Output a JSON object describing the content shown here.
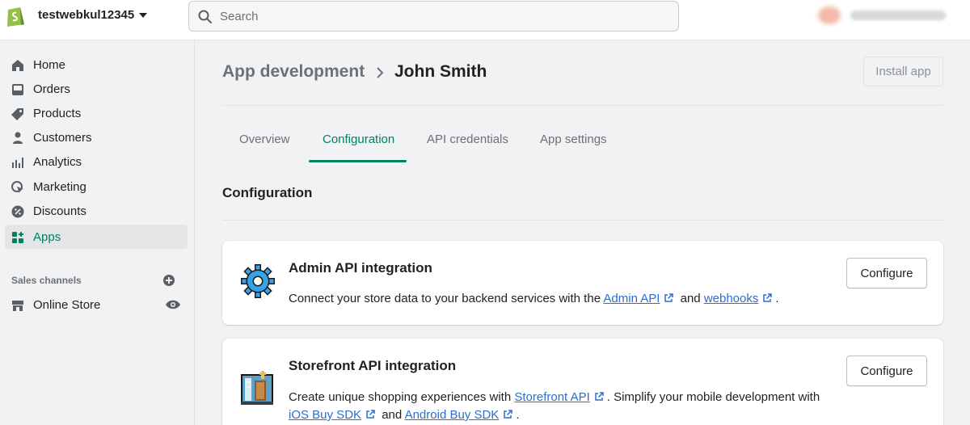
{
  "topbar": {
    "store_name": "testwebkul12345",
    "search_placeholder": "Search"
  },
  "sidebar": {
    "items": [
      {
        "label": "Home",
        "icon": "home-icon"
      },
      {
        "label": "Orders",
        "icon": "orders-icon"
      },
      {
        "label": "Products",
        "icon": "tag-icon"
      },
      {
        "label": "Customers",
        "icon": "person-icon"
      },
      {
        "label": "Analytics",
        "icon": "bar-chart-icon"
      },
      {
        "label": "Marketing",
        "icon": "marketing-icon"
      },
      {
        "label": "Discounts",
        "icon": "discount-icon"
      },
      {
        "label": "Apps",
        "icon": "apps-icon",
        "active": true
      }
    ],
    "sales_channels_title": "Sales channels",
    "channels": [
      {
        "label": "Online Store",
        "icon": "store-icon"
      }
    ]
  },
  "header": {
    "breadcrumb_parent": "App development",
    "title": "John Smith",
    "install_label": "Install app"
  },
  "tabs": [
    {
      "label": "Overview"
    },
    {
      "label": "Configuration",
      "active": true
    },
    {
      "label": "API credentials"
    },
    {
      "label": "App settings"
    }
  ],
  "section_title": "Configuration",
  "cards": {
    "admin": {
      "title": "Admin API integration",
      "desc_prefix": "Connect your store data to your backend services with the ",
      "link1": "Admin API",
      "and": "and",
      "link2": "webhooks",
      "period": ".",
      "button": "Configure"
    },
    "storefront": {
      "title": "Storefront API integration",
      "desc_prefix": "Create unique shopping experiences with ",
      "link1": "Storefront API",
      "middle": ". Simplify your mobile development with",
      "link2": "iOS Buy SDK",
      "and": "and",
      "link3": "Android Buy SDK",
      "period": ".",
      "button": "Configure"
    }
  },
  "colors": {
    "accent": "#008060",
    "link": "#2c6ecb"
  }
}
